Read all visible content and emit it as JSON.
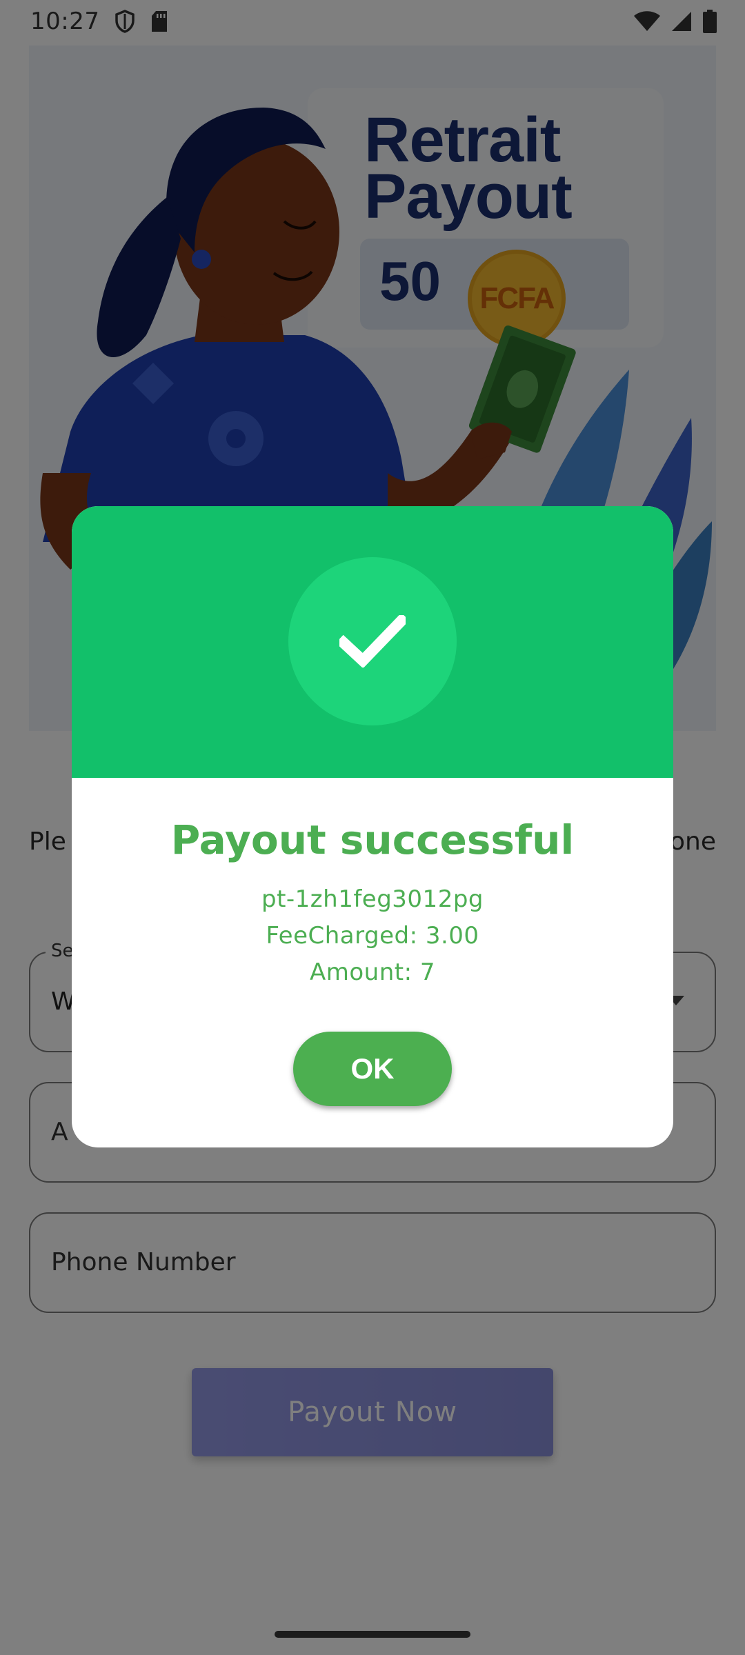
{
  "status_bar": {
    "time": "10:27",
    "left_icons": [
      "shield-icon",
      "sd-card-icon"
    ],
    "right_icons": [
      "wifi-icon",
      "cell-signal-icon",
      "battery-icon"
    ]
  },
  "hero": {
    "title_line1": "Retrait",
    "title_line2": "Payout",
    "amount": "50",
    "currency": "FCFA"
  },
  "form": {
    "instruction_start": "Ple",
    "instruction_end": "one",
    "select": {
      "label": "Se",
      "value": "W"
    },
    "amount_field": {
      "placeholder": "A"
    },
    "phone_field": {
      "placeholder": "Phone Number"
    },
    "submit_label": "Payout Now"
  },
  "dialog": {
    "title": "Payout successful",
    "payout_id": "pt-1zh1feg3012pg",
    "fee_line": "FeeCharged: 3.00",
    "amount_line": "Amount: 7",
    "ok_label": "OK"
  },
  "colors": {
    "dialog_header": "#12c06a",
    "check_circle": "#1dd47a",
    "success_text": "#4cae52",
    "ok_button": "#4caf50",
    "payout_button": "#5a63d8"
  }
}
